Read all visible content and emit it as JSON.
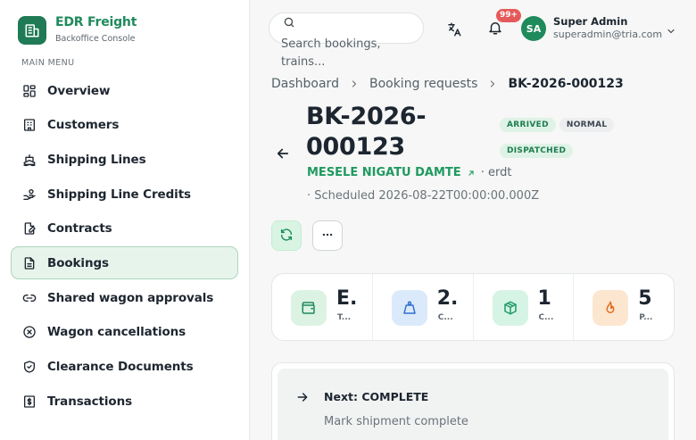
{
  "brand": {
    "name": "EDR Freight",
    "subtitle": "Backoffice Console"
  },
  "sidebar": {
    "heading": "MAIN MENU",
    "items": [
      {
        "label": "Overview",
        "icon": "grid-icon",
        "active": false
      },
      {
        "label": "Customers",
        "icon": "building-icon",
        "active": false
      },
      {
        "label": "Shipping Lines",
        "icon": "ship-icon",
        "active": false
      },
      {
        "label": "Shipping Line Credits",
        "icon": "hand-coins-icon",
        "active": false
      },
      {
        "label": "Contracts",
        "icon": "file-signature-icon",
        "active": false
      },
      {
        "label": "Bookings",
        "icon": "file-text-icon",
        "active": true
      },
      {
        "label": "Shared wagon approvals",
        "icon": "link-icon",
        "active": false
      },
      {
        "label": "Wagon cancellations",
        "icon": "x-circle-icon",
        "active": false
      },
      {
        "label": "Clearance Documents",
        "icon": "shield-check-icon",
        "active": false
      },
      {
        "label": "Transactions",
        "icon": "dollar-receipt-icon",
        "active": false
      }
    ]
  },
  "header": {
    "search_placeholder": "Search bookings, trains...",
    "notification_count": "99+",
    "user": {
      "initials": "SA",
      "name": "Super Admin",
      "email": "superadmin@tria.com"
    }
  },
  "breadcrumb": [
    "Dashboard",
    "Booking requests",
    "BK-2026-000123"
  ],
  "booking": {
    "id": "BK-2026-000123",
    "tags": [
      "ARRIVED",
      "NORMAL",
      "DISPATCHED"
    ],
    "customer": "MESELE NIGATU DAMTE",
    "customer_meta": "· erdt",
    "scheduled": "· Scheduled 2026-08-22T00:00:00.000Z"
  },
  "stats": [
    {
      "value": "E.",
      "label": "T...",
      "icon": "wallet-icon",
      "color": "#dcf3e4",
      "stroke": "#1f8a5c"
    },
    {
      "value": "2.",
      "label": "C...",
      "icon": "weight-icon",
      "color": "#dbeafb",
      "stroke": "#2f6fd0"
    },
    {
      "value": "1",
      "label": "C...",
      "icon": "package-icon",
      "color": "#d6f4e5",
      "stroke": "#1f9a68"
    },
    {
      "value": "5",
      "label": "P...",
      "icon": "flame-icon",
      "color": "#fde6cf",
      "stroke": "#e0701f"
    }
  ],
  "next_step": {
    "title": "Next: COMPLETE",
    "description": "Mark shipment complete"
  },
  "colors": {
    "accent": "#1f8a5c",
    "badge": "#e45a5a"
  }
}
